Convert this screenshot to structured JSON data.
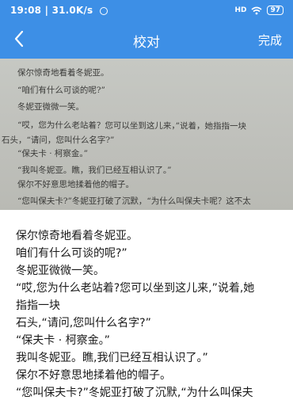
{
  "status": {
    "time": "19:08",
    "speed": "31.0K/s",
    "signal": "HD",
    "battery": "97"
  },
  "nav": {
    "title": "校对",
    "done_label": "完成"
  },
  "photo_lines": [
    "保尔惊奇地看着冬妮亚。",
    "“咱们有什么可谈的呢?”",
    "冬妮亚微微一笑。",
    "“哎，您为什么老站着？您可以坐到这儿来，”说着，她指指一块",
    "石头，“请问，您叫什么名字?”",
    "“保夫卡 · 柯察金。”",
    "“我叫冬妮亚。瞧，我们已经互相认识了。”",
    "保尔不好意思地揉着他的帽子。",
    "“您叫保夫卡?”冬妮亚打破了沉默，“为什么叫保夫卡呢？这不太"
  ],
  "result_lines": [
    "保尔惊奇地看着冬妮亚。",
    "咱们有什么可谈的呢?”",
    "冬妮亚微微一笑。",
    "“哎,您为什么老站着?您可以坐到这儿来,”说着,她",
    "指指一块",
    "石头,“请问,您叫什么名字?”",
    "“保夫卡 · 柯察金。”",
    "我叫冬妮亚。瞧,我们已经互相认识了。”",
    "保尔不好意思地揉着他的帽子。",
    "“您叫保夫卡?”冬妮亚打破了沉默,“为什么叫保夫"
  ]
}
